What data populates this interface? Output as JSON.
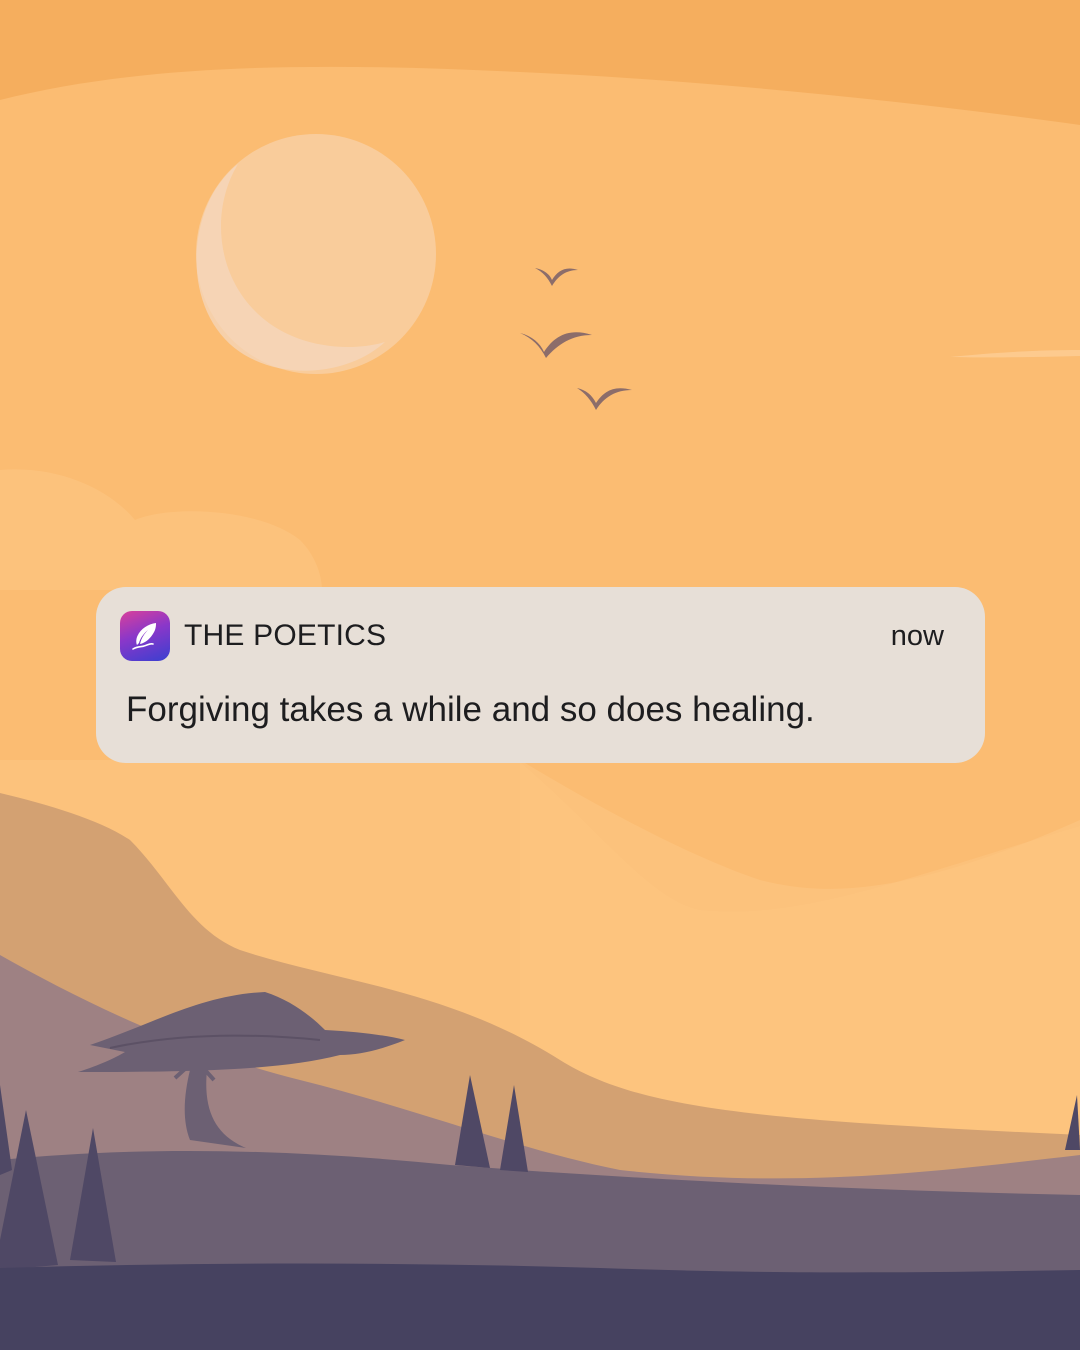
{
  "notification": {
    "app_name": "THE POETICS",
    "time": "now",
    "message": "Forgiving takes a while and so does healing.",
    "app_icon": "quill-feather-icon"
  },
  "background": {
    "description_icons": [
      "moon-icon",
      "bird-icon",
      "tree-icon"
    ],
    "colors": {
      "sky_top": "#f5ae5e",
      "sky": "#fbbc72",
      "cloud": "#fcc27c",
      "moon": "#f9cc9b",
      "hill_far": "#d3a172",
      "hill_mid": "#9e8183",
      "hill_near": "#6c6073",
      "ground": "#464260"
    }
  }
}
